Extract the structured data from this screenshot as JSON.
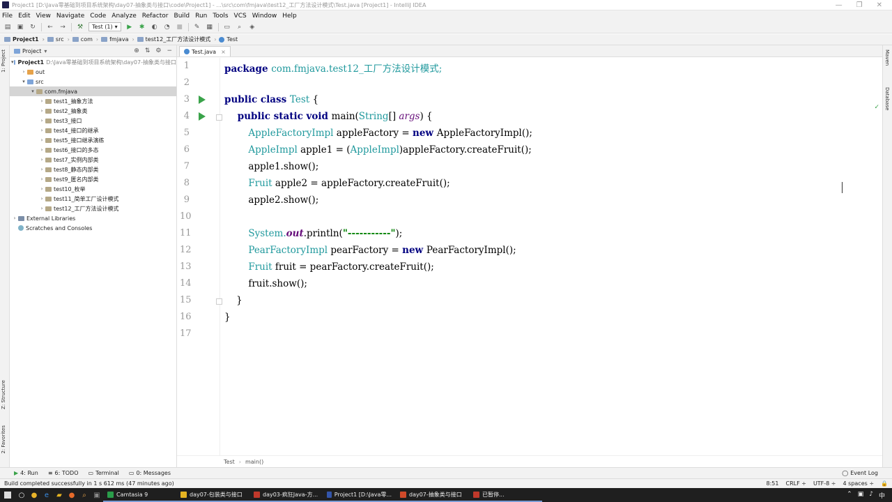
{
  "window": {
    "title": "Project1 [D:\\Java零基础到项目系统架构\\day07-抽象类与接口\\code\\Project1] - ...\\src\\com\\fmjava\\test12_工厂方法设计模式\\Test.java [Project1] - IntelliJ IDEA",
    "minimize": "—",
    "maximize": "❐",
    "close": "✕"
  },
  "menu": [
    "File",
    "Edit",
    "View",
    "Navigate",
    "Code",
    "Analyze",
    "Refactor",
    "Build",
    "Run",
    "Tools",
    "VCS",
    "Window",
    "Help"
  ],
  "toolbar": {
    "run_config": "Test (1)",
    "dropdown": "▾"
  },
  "breadcrumbs": [
    "Project1",
    "src",
    "com",
    "fmjava",
    "test12_工厂方法设计模式",
    "Test"
  ],
  "left_tabs": [
    "1: Project",
    "Z: Structure",
    "2: Favorites"
  ],
  "right_tabs": [
    "Maven",
    "Database"
  ],
  "project_panel": {
    "title": "Project",
    "tree": [
      {
        "label": "Project1",
        "path": "D:\\Java零基础到项目系统架构\\day07-抽象类与接口",
        "arrow": "▾",
        "indent": 0,
        "icon": "blue",
        "bold": true
      },
      {
        "label": "out",
        "arrow": "›",
        "indent": 1,
        "icon": "orange"
      },
      {
        "label": "src",
        "arrow": "▾",
        "indent": 1,
        "icon": "blue"
      },
      {
        "label": "com.fmjava",
        "arrow": "▾",
        "indent": 2,
        "icon": "pkg",
        "selected": true
      },
      {
        "label": "test1_抽象方法",
        "arrow": "›",
        "indent": 3,
        "icon": "pkg"
      },
      {
        "label": "test2_抽象类",
        "arrow": "›",
        "indent": 3,
        "icon": "pkg"
      },
      {
        "label": "test3_接口",
        "arrow": "›",
        "indent": 3,
        "icon": "pkg"
      },
      {
        "label": "test4_接口的继承",
        "arrow": "›",
        "indent": 3,
        "icon": "pkg"
      },
      {
        "label": "test5_接口继承演练",
        "arrow": "›",
        "indent": 3,
        "icon": "pkg"
      },
      {
        "label": "test6_接口的多态",
        "arrow": "›",
        "indent": 3,
        "icon": "pkg"
      },
      {
        "label": "test7_实例内部类",
        "arrow": "›",
        "indent": 3,
        "icon": "pkg"
      },
      {
        "label": "test8_静态内部类",
        "arrow": "›",
        "indent": 3,
        "icon": "pkg"
      },
      {
        "label": "test9_匿名内部类",
        "arrow": "›",
        "indent": 3,
        "icon": "pkg"
      },
      {
        "label": "test10_枚举",
        "arrow": "›",
        "indent": 3,
        "icon": "pkg"
      },
      {
        "label": "test11_简单工厂设计模式",
        "arrow": "›",
        "indent": 3,
        "icon": "pkg"
      },
      {
        "label": "test12_工厂方法设计模式",
        "arrow": "›",
        "indent": 3,
        "icon": "pkg"
      },
      {
        "label": "External Libraries",
        "arrow": "›",
        "indent": 0,
        "icon": "lib"
      },
      {
        "label": "Scratches and Consoles",
        "arrow": "",
        "indent": 0,
        "icon": "scratch"
      }
    ]
  },
  "editor": {
    "tab": "Test.java",
    "tab_close": "×",
    "line_numbers": [
      "1",
      "2",
      "3",
      "4",
      "5",
      "6",
      "7",
      "8",
      "9",
      "10",
      "11",
      "12",
      "13",
      "14",
      "15",
      "16",
      "17"
    ],
    "code_lines": [
      [
        {
          "t": "package ",
          "c": "kw"
        },
        {
          "t": "com.fmjava.test12_工厂方法设计模式;",
          "c": "pk"
        }
      ],
      [],
      [
        {
          "t": "public class ",
          "c": "kw"
        },
        {
          "t": "Test",
          "c": "ty"
        },
        {
          "t": " {",
          "c": ""
        }
      ],
      [
        {
          "t": "    public static void ",
          "c": "kw"
        },
        {
          "t": "main(",
          "c": ""
        },
        {
          "t": "String",
          "c": "ty"
        },
        {
          "t": "[] ",
          "c": ""
        },
        {
          "t": "args",
          "c": "it"
        },
        {
          "t": ") {",
          "c": ""
        }
      ],
      [
        {
          "t": "        ",
          "c": ""
        },
        {
          "t": "AppleFactoryImpl",
          "c": "ty"
        },
        {
          "t": " appleFactory = ",
          "c": ""
        },
        {
          "t": "new ",
          "c": "kw"
        },
        {
          "t": "AppleFactoryImpl();",
          "c": ""
        }
      ],
      [
        {
          "t": "        ",
          "c": ""
        },
        {
          "t": "AppleImpl",
          "c": "ty"
        },
        {
          "t": " apple1 = (",
          "c": ""
        },
        {
          "t": "AppleImpl",
          "c": "ty"
        },
        {
          "t": ")appleFactory.createFruit();",
          "c": ""
        }
      ],
      [
        {
          "t": "        apple1.show();",
          "c": ""
        }
      ],
      [
        {
          "t": "        ",
          "c": ""
        },
        {
          "t": "Fruit",
          "c": "ty"
        },
        {
          "t": " apple2 = appleFactory.createFruit();",
          "c": ""
        }
      ],
      [
        {
          "t": "        apple2.show();",
          "c": ""
        }
      ],
      [],
      [
        {
          "t": "        ",
          "c": ""
        },
        {
          "t": "System.",
          "c": "ty"
        },
        {
          "t": "out",
          "c": "field"
        },
        {
          "t": ".println(",
          "c": ""
        },
        {
          "t": "\"-----------\"",
          "c": "st"
        },
        {
          "t": ");",
          "c": ""
        }
      ],
      [
        {
          "t": "        ",
          "c": ""
        },
        {
          "t": "PearFactoryImpl",
          "c": "ty"
        },
        {
          "t": " pearFactory = ",
          "c": ""
        },
        {
          "t": "new ",
          "c": "kw"
        },
        {
          "t": "PearFactoryImpl();",
          "c": ""
        }
      ],
      [
        {
          "t": "        ",
          "c": ""
        },
        {
          "t": "Fruit",
          "c": "ty"
        },
        {
          "t": " fruit = pearFactory.createFruit();",
          "c": ""
        }
      ],
      [
        {
          "t": "        fruit.show();",
          "c": ""
        }
      ],
      [
        {
          "t": "    }",
          "c": ""
        }
      ],
      [
        {
          "t": "}",
          "c": ""
        }
      ],
      []
    ],
    "crumbs": [
      "Test",
      "main()"
    ],
    "inspection_mark": "✓"
  },
  "tool_windows": [
    {
      "icon": "▶",
      "label": "4: Run"
    },
    {
      "icon": "≡",
      "label": "6: TODO"
    },
    {
      "icon": "▭",
      "label": "Terminal"
    },
    {
      "icon": "▭",
      "label": "0: Messages"
    }
  ],
  "event_log": "Event Log",
  "status": {
    "message": "Build completed successfully in 1 s 612 ms (47 minutes ago)",
    "position": "8:51",
    "line_sep": "CRLF ÷",
    "encoding": "UTF-8 ÷",
    "indent": "4 spaces ÷"
  },
  "taskbar": {
    "items": [
      {
        "label": "Camtasia 9",
        "color": "#2a9d4a"
      },
      {
        "label": "day07-包装类与接口",
        "color": "#e6b422"
      },
      {
        "label": "day03-疯狂Java-方...",
        "color": "#c0392b"
      },
      {
        "label": "Project1 [D:\\Java零...",
        "color": "#3355aa"
      },
      {
        "label": "day07-抽象类与接口",
        "color": "#d04a2a"
      },
      {
        "label": "已暂停...",
        "color": "#c0392b"
      }
    ],
    "tray": [
      "⌃",
      "▣",
      "♪",
      "中"
    ]
  }
}
